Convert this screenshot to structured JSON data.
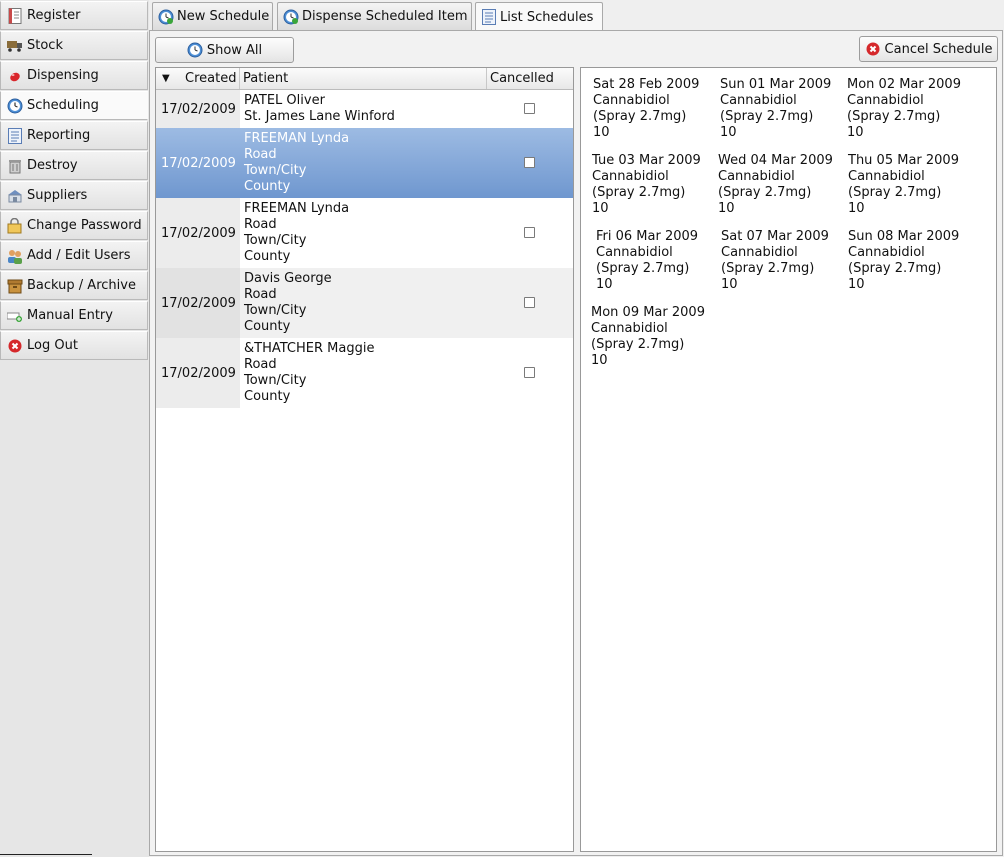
{
  "sidebar": {
    "items": [
      {
        "label": "Register",
        "icon": "register-icon"
      },
      {
        "label": "Stock",
        "icon": "truck-icon"
      },
      {
        "label": "Dispensing",
        "icon": "pill-icon"
      },
      {
        "label": "Scheduling",
        "icon": "clock-icon"
      },
      {
        "label": "Reporting",
        "icon": "report-icon"
      },
      {
        "label": "Destroy",
        "icon": "bin-icon"
      },
      {
        "label": "Suppliers",
        "icon": "supplier-icon"
      },
      {
        "label": "Change Password",
        "icon": "lock-icon"
      },
      {
        "label": "Add / Edit Users",
        "icon": "users-icon"
      },
      {
        "label": "Backup / Archive",
        "icon": "archive-icon"
      },
      {
        "label": "Manual Entry",
        "icon": "manual-entry-icon"
      },
      {
        "label": "Log Out",
        "icon": "logout-icon"
      }
    ],
    "active_index": 3
  },
  "tabs": [
    {
      "label": "New Schedule",
      "icon": "clock-add-icon"
    },
    {
      "label": "Dispense Scheduled Item",
      "icon": "clock-dispense-icon"
    },
    {
      "label": "List Schedules",
      "icon": "list-icon"
    }
  ],
  "toolbar": {
    "show_all_label": "Show All",
    "cancel_schedule_label": "Cancel Schedule"
  },
  "table": {
    "headers": {
      "created": "Created",
      "patient": "Patient",
      "cancelled": "Cancelled"
    },
    "rows": [
      {
        "created": "17/02/2009",
        "patient": [
          "PATEL Oliver",
          "St. James Lane Winford"
        ],
        "cancelled": false
      },
      {
        "created": "17/02/2009",
        "patient": [
          "FREEMAN Lynda",
          "Road",
          "Town/City",
          "County"
        ],
        "cancelled": false,
        "selected": true
      },
      {
        "created": "17/02/2009",
        "patient": [
          "FREEMAN Lynda",
          "Road",
          "Town/City",
          "County"
        ],
        "cancelled": false
      },
      {
        "created": "17/02/2009",
        "patient": [
          "Davis George",
          "Road",
          "Town/City",
          "County"
        ],
        "cancelled": false
      },
      {
        "created": "17/02/2009",
        "patient": [
          "&THATCHER Maggie",
          "Road",
          "Town/City",
          "County"
        ],
        "cancelled": false
      }
    ]
  },
  "schedule": [
    {
      "date": "Sat 28 Feb 2009",
      "drug": "Cannabidiol",
      "form": "(Spray 2.7mg)",
      "qty": "10"
    },
    {
      "date": "Sun 01 Mar 2009",
      "drug": "Cannabidiol",
      "form": "(Spray 2.7mg)",
      "qty": "10"
    },
    {
      "date": "Mon 02 Mar 2009",
      "drug": "Cannabidiol",
      "form": "(Spray 2.7mg)",
      "qty": "10"
    },
    {
      "date": "Tue 03 Mar 2009",
      "drug": "Cannabidiol",
      "form": "(Spray 2.7mg)",
      "qty": "10"
    },
    {
      "date": "Wed 04 Mar 2009",
      "drug": "Cannabidiol",
      "form": "(Spray 2.7mg)",
      "qty": "10"
    },
    {
      "date": "Thu 05 Mar 2009",
      "drug": "Cannabidiol",
      "form": "(Spray 2.7mg)",
      "qty": "10"
    },
    {
      "date": "Fri 06 Mar 2009",
      "drug": "Cannabidiol",
      "form": "(Spray 2.7mg)",
      "qty": "10"
    },
    {
      "date": "Sat 07 Mar 2009",
      "drug": "Cannabidiol",
      "form": "(Spray 2.7mg)",
      "qty": "10"
    },
    {
      "date": "Sun 08 Mar 2009",
      "drug": "Cannabidiol",
      "form": "(Spray 2.7mg)",
      "qty": "10"
    },
    {
      "date": "Mon 09 Mar 2009",
      "drug": "Cannabidiol",
      "form": "(Spray 2.7mg)",
      "qty": "10"
    }
  ]
}
